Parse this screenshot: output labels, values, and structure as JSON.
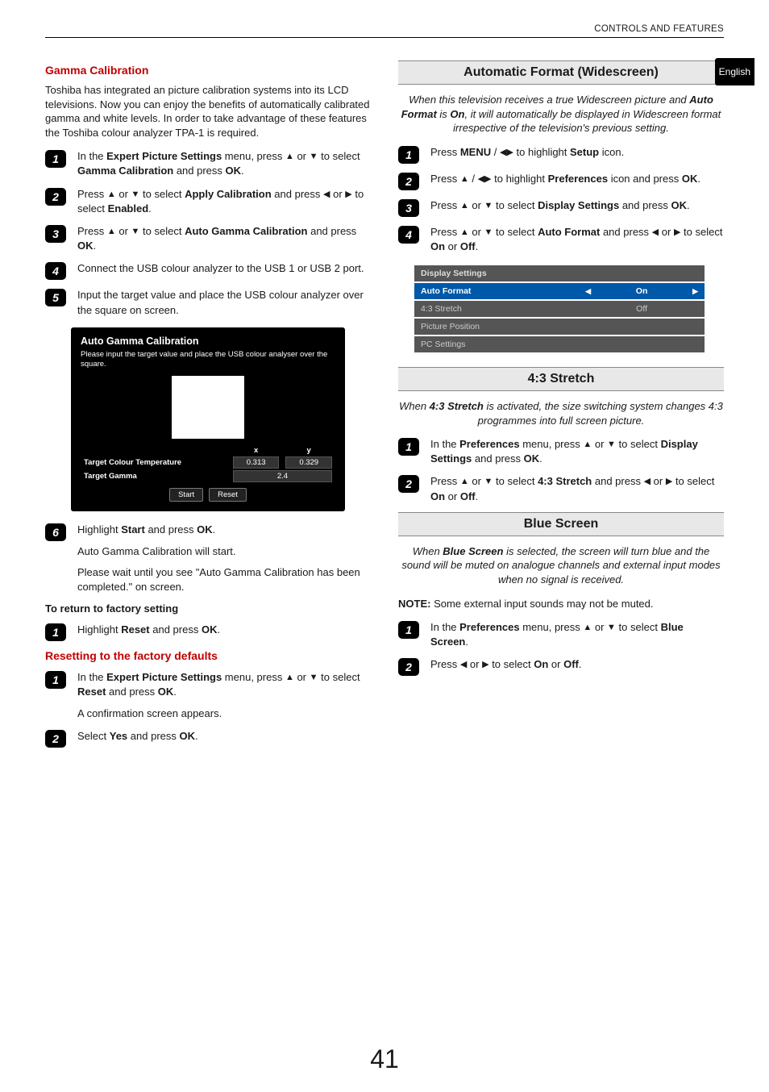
{
  "header": {
    "breadcrumb": "CONTROLS AND FEATURES"
  },
  "side_tab": "English",
  "page_number": "41",
  "left": {
    "gamma_heading": "Gamma Calibration",
    "gamma_intro": "Toshiba has integrated an picture calibration systems into its LCD televisions. Now you can enjoy the benefits of automatically calibrated gamma and white levels. In order to take advantage of these features the Toshiba colour analyzer TPA-1 is required.",
    "steps": [
      {
        "n": "1",
        "html": "In the <b>Expert Picture Settings</b> menu, press <span class='tri'>▲</span> or <span class='tri'>▼</span> to select <b>Gamma Calibration</b> and press <b>OK</b>."
      },
      {
        "n": "2",
        "html": "Press <span class='tri'>▲</span> or <span class='tri'>▼</span> to select <b>Apply Calibration</b> and press <span class='tri'>◀</span> or <span class='tri'>▶</span> to select <b>Enabled</b>."
      },
      {
        "n": "3",
        "html": "Press <span class='tri'>▲</span> or <span class='tri'>▼</span> to select <b>Auto Gamma Calibration</b> and press <b>OK</b>."
      },
      {
        "n": "4",
        "html": "Connect the USB colour analyzer to the USB 1 or USB 2 port."
      },
      {
        "n": "5",
        "html": "Input the target value and place the USB colour analyzer over the square on screen."
      }
    ],
    "osd": {
      "title": "Auto Gamma Calibration",
      "hint": "Please input the target value and place the USB colour analyser over the square.",
      "x_label": "x",
      "y_label": "y",
      "row1_label": "Target Colour Temperature",
      "row1_x": "0.313",
      "row1_y": "0.329",
      "row2_label": "Target Gamma",
      "row2_val": "2.4",
      "btn_start": "Start",
      "btn_reset": "Reset"
    },
    "step6": {
      "n": "6",
      "line1_html": "Highlight <b>Start</b> and press <b>OK</b>.",
      "line2": "Auto Gamma Calibration will start.",
      "line3": "Please wait until you see \"Auto Gamma Calibration has been completed.\" on screen."
    },
    "return_label": "To return to factory setting",
    "return_step": {
      "n": "1",
      "html": "Highlight <b>Reset</b> and press <b>OK</b>."
    },
    "reset_heading": "Resetting to the factory defaults",
    "reset_steps": [
      {
        "n": "1",
        "line1_html": "In the <b>Expert Picture Settings</b> menu, press <span class='tri'>▲</span> or <span class='tri'>▼</span> to select <b>Reset</b> and press <b>OK</b>.",
        "line2": "A confirmation screen appears."
      },
      {
        "n": "2",
        "line1_html": "Select <b>Yes</b> and press <b>OK</b>."
      }
    ]
  },
  "right": {
    "auto_format": {
      "title": "Automatic Format (Widescreen)",
      "intro_html": "When this television receives a true Widescreen picture and <b>Auto Format</b> is <b>On</b>, it will automatically be displayed in Widescreen format irrespective of the television's previous setting.",
      "steps": [
        {
          "n": "1",
          "html": "Press <b>MENU</b> / <span class='tri'>◀</span><span class='tri'>▶</span> to highlight <b>Setup</b> icon."
        },
        {
          "n": "2",
          "html": "Press <span class='tri'>▲</span> / <span class='tri'>◀</span><span class='tri'>▶</span> to highlight <b>Preferences</b> icon and press <b>OK</b>."
        },
        {
          "n": "3",
          "html": "Press <span class='tri'>▲</span> or <span class='tri'>▼</span> to select <b>Display Settings</b> and press <b>OK</b>."
        },
        {
          "n": "4",
          "html": "Press <span class='tri'>▲</span> or <span class='tri'>▼</span> to select <b>Auto Format</b> and press <span class='tri'>◀</span> or <span class='tri'>▶</span> to select <b>On</b> or <b>Off</b>."
        }
      ],
      "menu": {
        "header": "Display Settings",
        "rows": [
          {
            "label": "Auto Format",
            "value": "On",
            "selected": true,
            "arrows": true
          },
          {
            "label": "4:3 Stretch",
            "value": "Off",
            "selected": false,
            "arrows": false
          },
          {
            "label": "Picture Position",
            "value": "",
            "selected": false,
            "arrows": false
          },
          {
            "label": "PC Settings",
            "value": "",
            "selected": false,
            "arrows": false
          }
        ]
      }
    },
    "stretch": {
      "title": "4:3 Stretch",
      "intro_html": "When <b>4:3 Stretch</b> is activated, the size switching system changes 4:3 programmes into full screen picture.",
      "steps": [
        {
          "n": "1",
          "html": "In the <b>Preferences</b> menu, press <span class='tri'>▲</span> or <span class='tri'>▼</span> to select <b>Display Settings</b> and press <b>OK</b>."
        },
        {
          "n": "2",
          "html": "Press <span class='tri'>▲</span> or <span class='tri'>▼</span> to select <b>4:3 Stretch</b> and press <span class='tri'>◀</span> or <span class='tri'>▶</span> to select <b>On</b> or <b>Off</b>."
        }
      ]
    },
    "blue": {
      "title": "Blue Screen",
      "intro_html": "When <b>Blue Screen</b> is selected, the screen will turn blue and the sound will be muted on analogue channels and external input modes when no signal is received.",
      "note_label": "NOTE:",
      "note_text": " Some external input sounds may not be muted.",
      "steps": [
        {
          "n": "1",
          "html": "In the <b>Preferences</b> menu, press <span class='tri'>▲</span> or <span class='tri'>▼</span> to select <b>Blue Screen</b>."
        },
        {
          "n": "2",
          "html": "Press <span class='tri'>◀</span> or <span class='tri'>▶</span> to select <b>On</b> or <b>Off</b>."
        }
      ]
    }
  }
}
